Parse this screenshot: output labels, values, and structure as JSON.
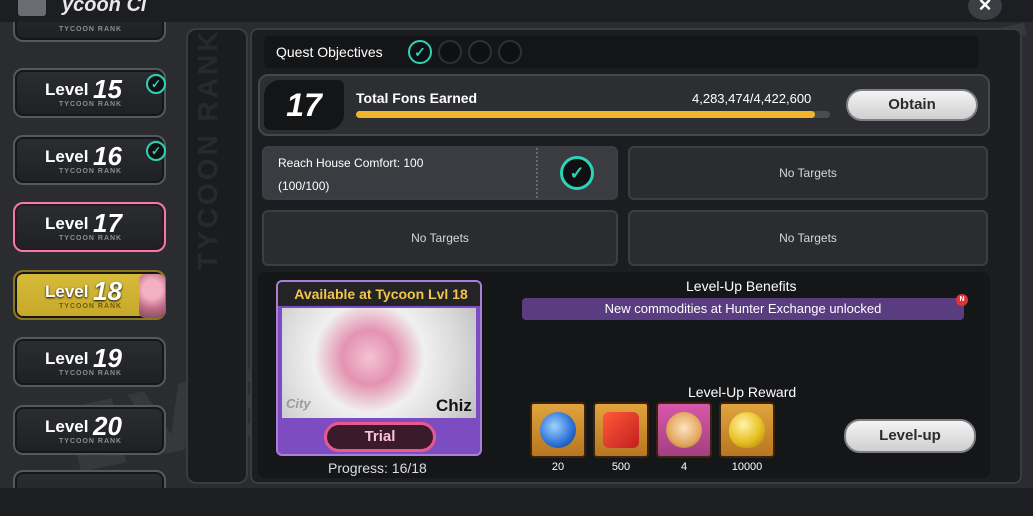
{
  "window": {
    "title": "ycoon Ci"
  },
  "sidebar": {
    "rank_label": "TYCOON RANK",
    "levels": [
      {
        "label": "Level",
        "number": "15",
        "completed": true
      },
      {
        "label": "Level",
        "number": "16",
        "completed": true
      },
      {
        "label": "Level",
        "number": "17",
        "completed": false,
        "active": true
      },
      {
        "label": "Level",
        "number": "18",
        "completed": false
      },
      {
        "label": "Level",
        "number": "19",
        "completed": false
      },
      {
        "label": "Level",
        "number": "20",
        "completed": false
      }
    ]
  },
  "strip": {
    "text": "TYCOON RANK"
  },
  "quest": {
    "label": "Quest Objectives",
    "dots_completed": 1,
    "dots_total": 4
  },
  "fons": {
    "level": "17",
    "title": "Total Fons Earned",
    "value_text": "4,283,474/4,422,600",
    "current": 4283474,
    "target": 4422600,
    "obtain_label": "Obtain"
  },
  "targets": {
    "active": {
      "name": "Reach House Comfort: 100",
      "progress": "(100/100)"
    },
    "empty_label": "No Targets"
  },
  "character": {
    "available_label": "Available at Tycoon Lvl 18",
    "name": "Chiz",
    "city": "City",
    "trial_label": "Trial",
    "progress_text": "Progress: 16/18"
  },
  "benefits": {
    "title": "Level-Up Benefits",
    "text": "New commodities at Hunter Exchange unlocked",
    "badge": "N"
  },
  "rewards": {
    "title": "Level-Up Reward",
    "items": [
      {
        "icon": "blue-orb-icon",
        "qty": "20"
      },
      {
        "icon": "hunter-ticket-icon",
        "qty": "500"
      },
      {
        "icon": "pig-coin-icon",
        "qty": "4"
      },
      {
        "icon": "gold-egg-icon",
        "qty": "10000"
      }
    ],
    "levelup_label": "Level-up"
  },
  "colors": {
    "accent": "#2ed3b7",
    "gold": "#f2b42a",
    "active_border": "#f27aa8"
  }
}
